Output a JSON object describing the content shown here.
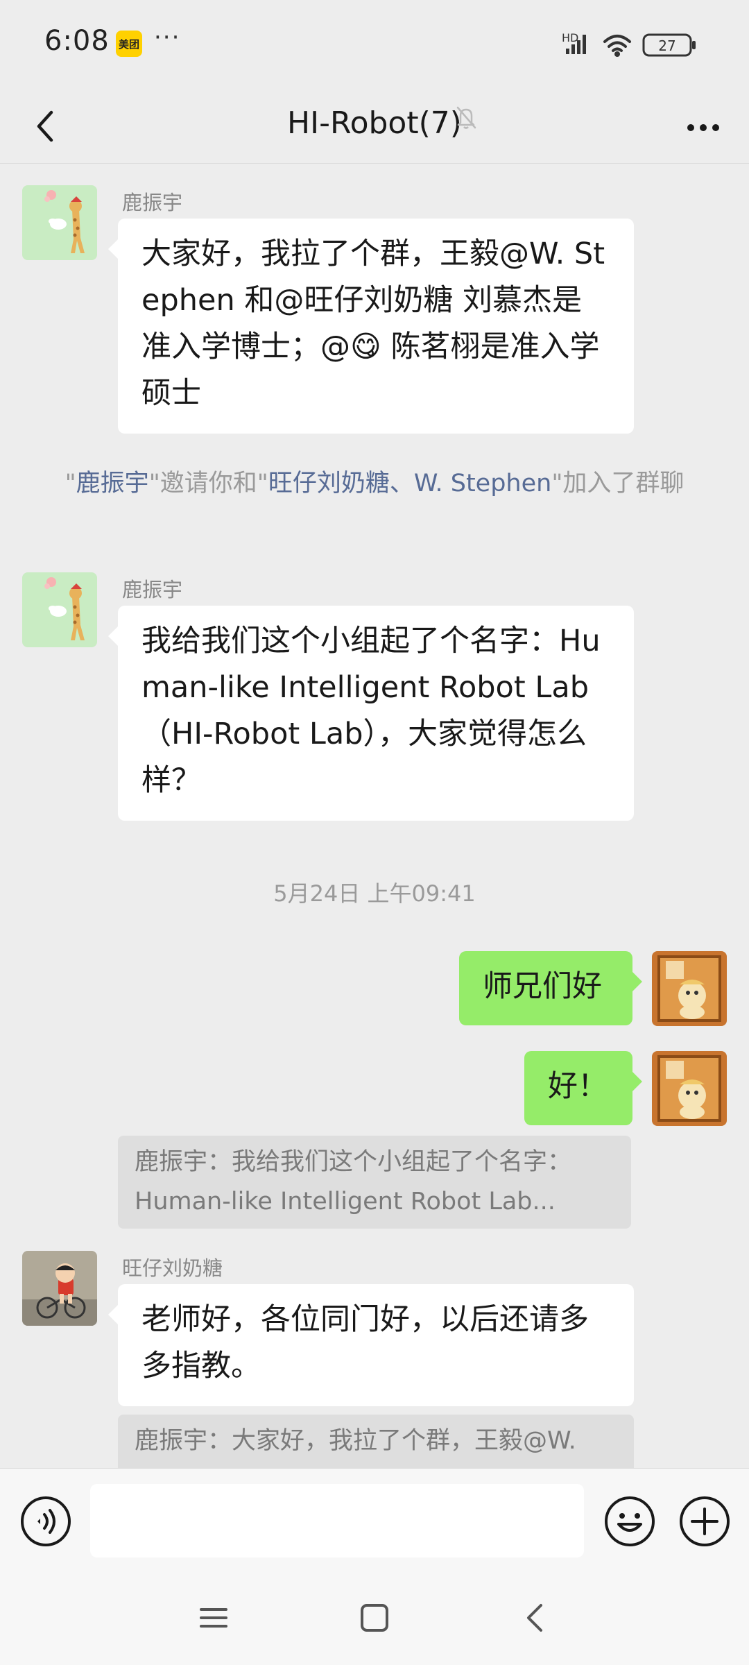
{
  "status_bar": {
    "time": "6:08",
    "app_badge": "美团",
    "dots": "···",
    "network": "HD",
    "battery": "27"
  },
  "nav": {
    "title": "HI-Robot(7)",
    "back_icon": "chevron-left-icon",
    "mute_icon": "bell-off-icon",
    "more_icon": "more-horizontal-icon"
  },
  "messages": [
    {
      "sender": "鹿振宇",
      "text": "大家好，我拉了个群，王毅@W. Stephen  和@旺仔刘奶糖  刘慕杰是准入学博士；@😋  陈茗栩是准入学硕士"
    },
    {
      "system": true,
      "parts": [
        "\"",
        "鹿振宇",
        "\"邀请你和\"",
        "旺仔刘奶糖、W. Stephen",
        "\"加入了群聊"
      ]
    },
    {
      "sender": "鹿振宇",
      "text": "我给我们这个小组起了个名字：Human-like Intelligent Robot Lab（HI-Robot Lab），大家觉得怎么样？"
    },
    {
      "time": "5月24日 上午09:41"
    },
    {
      "mine": true,
      "text": "师兄们好"
    },
    {
      "mine": true,
      "text": "好！",
      "quote": "鹿振宇：我给我们这个小组起了个名字：Human-like Intelligent Robot Lab..."
    },
    {
      "sender": "旺仔刘奶糖",
      "text": "老师好，各位同门好，以后还请多多指教。",
      "quote": "鹿振宇：大家好，我拉了个群，王毅@W."
    }
  ],
  "input_bar": {
    "placeholder": "",
    "voice_icon": "voice-icon",
    "emoji_icon": "emoji-icon",
    "plus_icon": "plus-circle-icon"
  },
  "system_nav": {
    "menu_icon": "menu-icon",
    "home_icon": "home-square-icon",
    "back_icon": "back-triangle-icon"
  },
  "colors": {
    "background": "#ededed",
    "my_bubble": "#95ec69",
    "other_bubble": "#ffffff",
    "link_blue": "#576b95",
    "meituan_yellow": "#ffd100"
  }
}
